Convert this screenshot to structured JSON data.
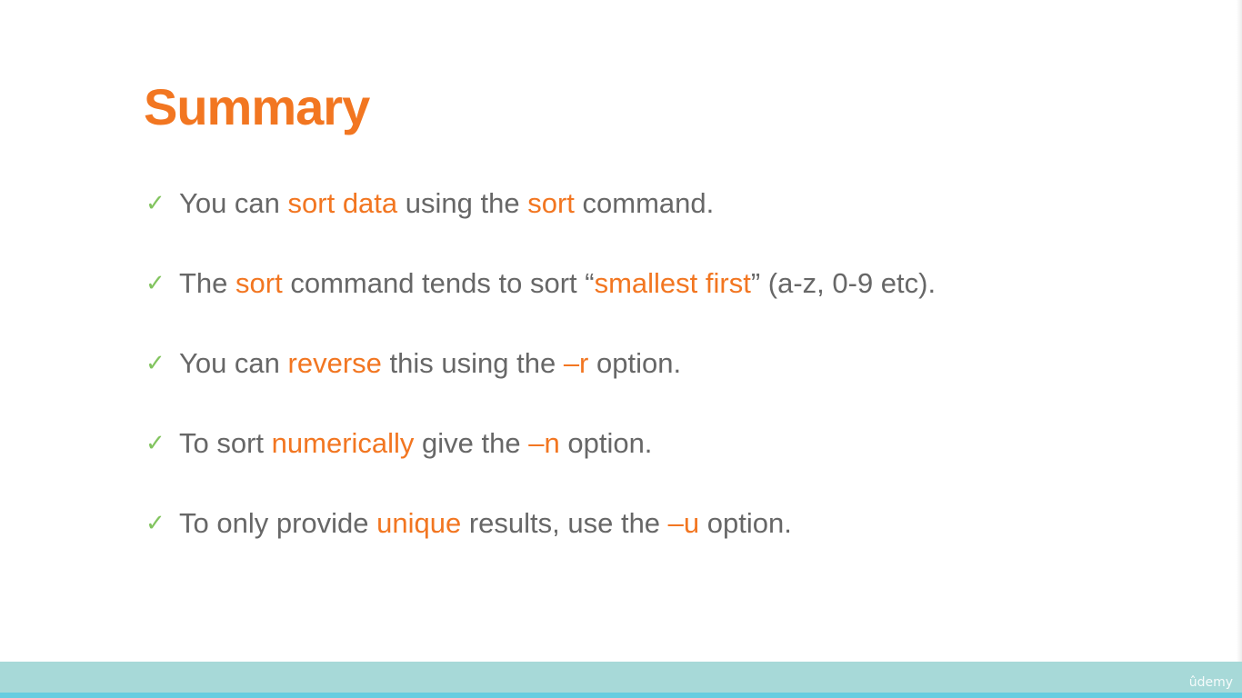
{
  "slide": {
    "title": "Summary",
    "bullets": [
      {
        "segments": [
          {
            "text": "You can ",
            "highlight": false
          },
          {
            "text": "sort data",
            "highlight": true
          },
          {
            "text": " using the ",
            "highlight": false
          },
          {
            "text": "sort",
            "highlight": true
          },
          {
            "text": " command.",
            "highlight": false
          }
        ]
      },
      {
        "segments": [
          {
            "text": "The ",
            "highlight": false
          },
          {
            "text": "sort",
            "highlight": true
          },
          {
            "text": " command tends to sort “",
            "highlight": false
          },
          {
            "text": "smallest first",
            "highlight": true
          },
          {
            "text": "” (a-z, 0-9 etc).",
            "highlight": false
          }
        ]
      },
      {
        "segments": [
          {
            "text": "You can ",
            "highlight": false
          },
          {
            "text": "reverse",
            "highlight": true
          },
          {
            "text": " this using the ",
            "highlight": false
          },
          {
            "text": "–r",
            "highlight": true
          },
          {
            "text": " option.",
            "highlight": false
          }
        ]
      },
      {
        "segments": [
          {
            "text": "To sort ",
            "highlight": false
          },
          {
            "text": "numerically",
            "highlight": true
          },
          {
            "text": " give the ",
            "highlight": false
          },
          {
            "text": "–n",
            "highlight": true
          },
          {
            "text": " option.",
            "highlight": false
          }
        ]
      },
      {
        "segments": [
          {
            "text": "To only provide ",
            "highlight": false
          },
          {
            "text": "unique",
            "highlight": true
          },
          {
            "text": " results, use the ",
            "highlight": false
          },
          {
            "text": "–u",
            "highlight": true
          },
          {
            "text": " option.",
            "highlight": false
          }
        ]
      }
    ]
  },
  "icons": {
    "bullet_marker": "check-icon"
  },
  "watermark": {
    "text": "ûdemy"
  },
  "colors": {
    "accent": "#f27621",
    "body_text": "#676767",
    "check": "#82c45f",
    "footer_bar": "#a7d9d8",
    "footer_line": "#66cde0"
  }
}
